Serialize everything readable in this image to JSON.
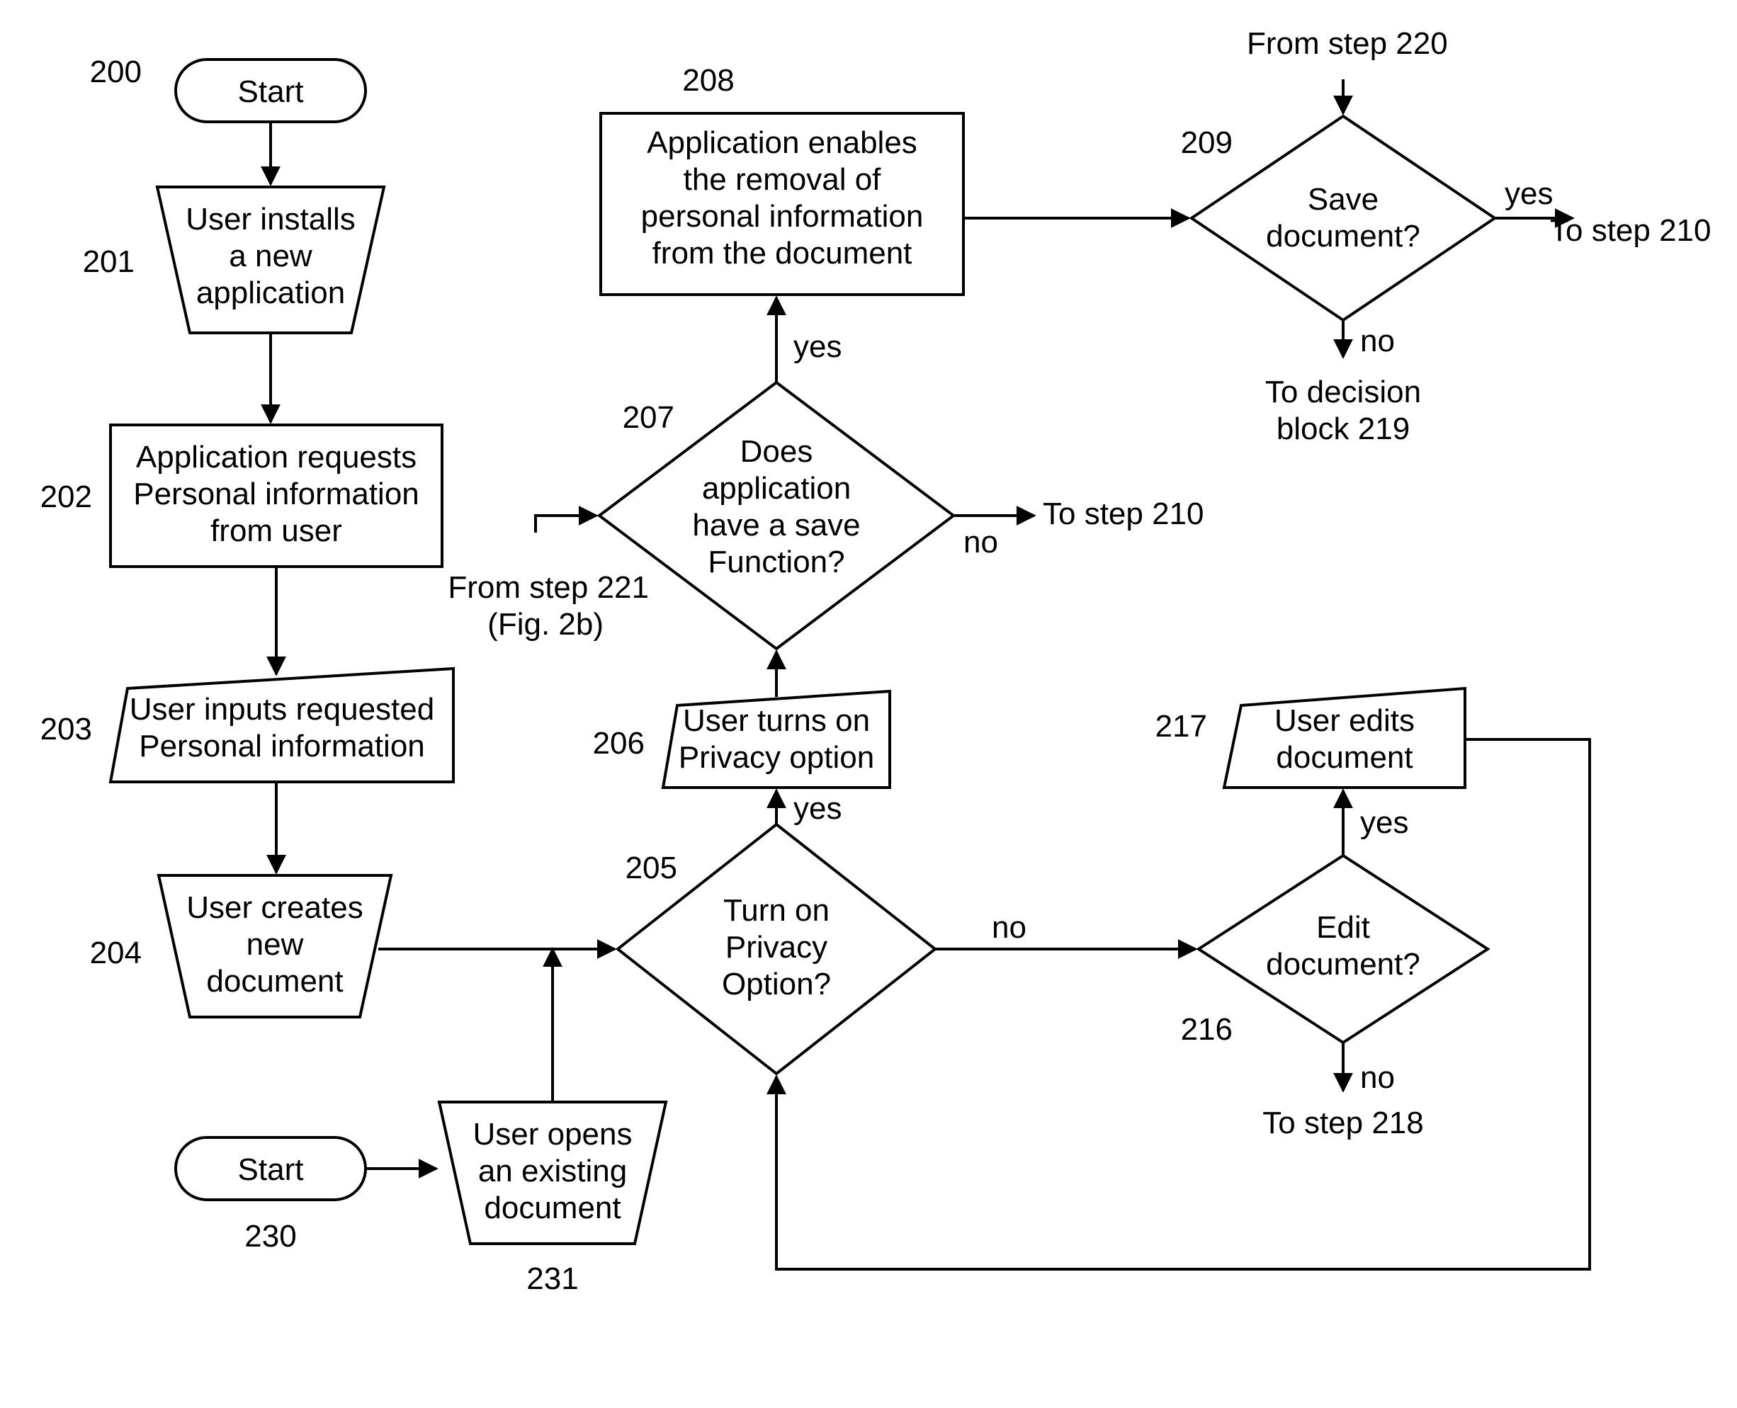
{
  "nodes": {
    "start1": {
      "num": "200",
      "text": "Start"
    },
    "n201": {
      "num": "201",
      "lines": [
        "User installs",
        "a new",
        "application"
      ]
    },
    "n202": {
      "num": "202",
      "lines": [
        "Application requests",
        "Personal information",
        "from user"
      ]
    },
    "n203": {
      "num": "203",
      "lines": [
        "User inputs requested",
        "Personal information"
      ]
    },
    "n204": {
      "num": "204",
      "lines": [
        "User creates",
        "new",
        "document"
      ]
    },
    "d205": {
      "num": "205",
      "lines": [
        "Turn on",
        "Privacy",
        "Option?"
      ]
    },
    "n206": {
      "num": "206",
      "lines": [
        "User turns on",
        "Privacy option"
      ]
    },
    "d207": {
      "num": "207",
      "lines": [
        "Does",
        "application",
        "have a save",
        "Function?"
      ]
    },
    "n208": {
      "num": "208",
      "lines": [
        "Application enables",
        "the removal of",
        "personal information",
        "from the document"
      ]
    },
    "d209": {
      "num": "209",
      "lines": [
        "Save",
        "document?"
      ]
    },
    "d216": {
      "num": "216",
      "lines": [
        "Edit",
        "document?"
      ]
    },
    "n217": {
      "num": "217",
      "lines": [
        "User edits",
        "document"
      ]
    },
    "start2": {
      "num": "230",
      "text": "Start"
    },
    "n231": {
      "num": "231",
      "lines": [
        "User opens",
        "an existing",
        "document"
      ]
    }
  },
  "labels": {
    "yes": "yes",
    "no": "no",
    "from220": "From step 220",
    "to210a": "To step 210",
    "to210b": "To step 210",
    "toDec219": [
      "To decision",
      "block 219"
    ],
    "to218": "To step 218",
    "from221": [
      "From step 221",
      "(Fig. 2b)"
    ]
  }
}
